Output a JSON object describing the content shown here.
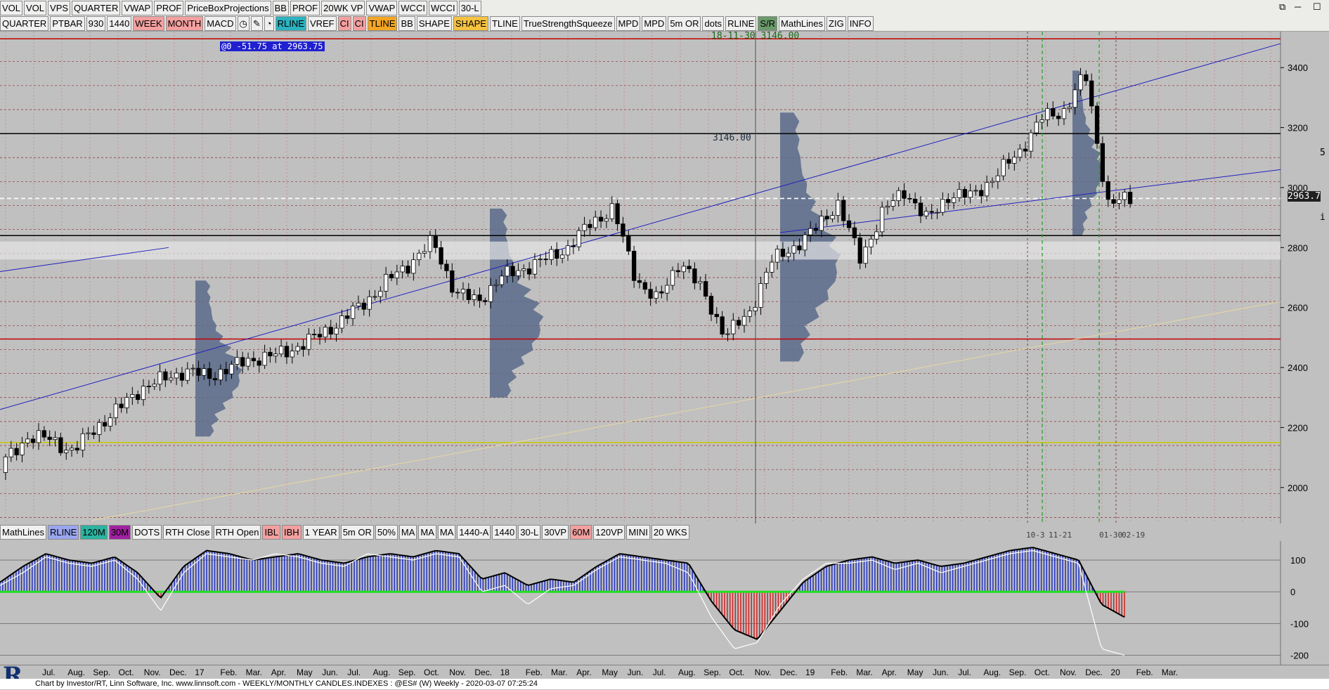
{
  "toolbar1": [
    "VOL",
    "VOL",
    "VPS",
    "QUARTER",
    "VWAP",
    "PROF",
    "PriceBoxProjections",
    "BB",
    "PROF",
    "20WK VP",
    "VWAP",
    "WCCI",
    "WCCI",
    "30-L"
  ],
  "toolbar2": [
    {
      "label": "QUARTER",
      "bg": "#f0f0f0"
    },
    {
      "label": "PTBAR",
      "bg": "#f0f0f0"
    },
    {
      "label": "930",
      "bg": "#f0f0f0"
    },
    {
      "label": "1440",
      "bg": "#f0f0f0"
    },
    {
      "label": "WEEK",
      "bg": "#f4a0a0"
    },
    {
      "label": "MONTH",
      "bg": "#f4a0a0"
    },
    {
      "label": "MACD",
      "bg": "#f0f0f0"
    },
    {
      "label": "clock-icon",
      "icon": true,
      "glyph": "◷"
    },
    {
      "label": "pencil-icon",
      "icon": true,
      "glyph": "✎"
    },
    {
      "label": "drop-icon",
      "icon": true,
      "glyph": "◔"
    },
    {
      "label": "RLINE",
      "bg": "#2bb3c0"
    },
    {
      "label": "VREF",
      "bg": "#f0f0f0"
    },
    {
      "label": "CI",
      "bg": "#f4a0a0"
    },
    {
      "label": "CI",
      "bg": "#f4a0a0"
    },
    {
      "label": "TLINE",
      "bg": "#f5a623"
    },
    {
      "label": "BB",
      "bg": "#f0f0f0"
    },
    {
      "label": "SHAPE",
      "bg": "#f0f0f0"
    },
    {
      "label": "SHAPE",
      "bg": "#f5c242"
    },
    {
      "label": "TLINE",
      "bg": "#f0f0f0"
    },
    {
      "label": "TrueStrengthSqueeze",
      "bg": "#f0f0f0"
    },
    {
      "label": "MPD",
      "bg": "#f0f0f0"
    },
    {
      "label": "MPD",
      "bg": "#f0f0f0"
    },
    {
      "label": "5m OR",
      "bg": "#f0f0f0"
    },
    {
      "label": "dots",
      "bg": "#f0f0f0"
    },
    {
      "label": "RLINE",
      "bg": "#f0f0f0"
    },
    {
      "label": "S/R",
      "bg": "#6b9a6b"
    },
    {
      "label": "MathLines",
      "bg": "#f0f0f0"
    },
    {
      "label": "ZIG",
      "bg": "#f0f0f0"
    },
    {
      "label": "INFO",
      "bg": "#f0f0f0"
    }
  ],
  "toolbar3": [
    {
      "label": "MathLines",
      "bg": "#f0f0f0"
    },
    {
      "label": "RLINE",
      "bg": "#9aa6f0"
    },
    {
      "label": "120M",
      "bg": "#2bb3a0"
    },
    {
      "label": "30M",
      "bg": "#a020a0"
    },
    {
      "label": "DOTS",
      "bg": "#f0f0f0"
    },
    {
      "label": "RTH Close",
      "bg": "#f0f0f0"
    },
    {
      "label": "RTH Open",
      "bg": "#f0f0f0"
    },
    {
      "label": "IBL",
      "bg": "#f4a0a0"
    },
    {
      "label": "IBH",
      "bg": "#f4a0a0"
    },
    {
      "label": "1 YEAR",
      "bg": "#f0f0f0"
    },
    {
      "label": "5m OR",
      "bg": "#f0f0f0"
    },
    {
      "label": "50%",
      "bg": "#f0f0f0"
    },
    {
      "label": "MA",
      "bg": "#f0f0f0"
    },
    {
      "label": "MA",
      "bg": "#f0f0f0"
    },
    {
      "label": "MA",
      "bg": "#f0f0f0"
    },
    {
      "label": "1440-A",
      "bg": "#f0f0f0"
    },
    {
      "label": "1440",
      "bg": "#f0f0f0"
    },
    {
      "label": "30-L",
      "bg": "#f0f0f0"
    },
    {
      "label": "30VP",
      "bg": "#f0f0f0"
    },
    {
      "label": "60M",
      "bg": "#f4a0a0"
    },
    {
      "label": "120VP",
      "bg": "#f0f0f0"
    },
    {
      "label": "MINI",
      "bg": "#f0f0f0"
    },
    {
      "label": "20 WKS",
      "bg": "#f0f0f0"
    }
  ],
  "labels": {
    "cursor_info": "@0  -51.75 at 2963.75",
    "date_price": "18-11-30 3146.00",
    "level_label": "3146.00",
    "price_tag": "2963.7",
    "marker_left": "10-3",
    "marker_mid": "11-21",
    "marker_right": "01-30",
    "marker_right2": "02-19",
    "side_mark_5": "5",
    "side_mark_i": "i"
  },
  "footer": "Chart by Investor/RT, Linn Software, Inc. www.linnsoft.com - WEEKLY/MONTHLY CANDLES.INDEXES : @ES# (W) Weekly - 2020-03-07 07:25:24",
  "logo": "R",
  "chart_data": [
    {
      "type": "candlestick",
      "title": "",
      "y_ticks": [
        2000,
        2200,
        2400,
        2600,
        2800,
        3000,
        3200,
        3400
      ],
      "ylim": [
        1880,
        3520
      ],
      "x_ticks": [
        "Jul.",
        "Aug.",
        "Sep.",
        "Oct.",
        "Nov.",
        "Dec.",
        "17",
        "Feb.",
        "Mar.",
        "Apr.",
        "May",
        "Jun.",
        "Jul.",
        "Aug.",
        "Sep.",
        "Oct.",
        "Nov.",
        "Dec.",
        "18",
        "Feb.",
        "Mar.",
        "Apr.",
        "May",
        "Jun.",
        "Jul.",
        "Aug.",
        "Sep.",
        "Oct.",
        "Nov.",
        "Dec.",
        "19",
        "Feb.",
        "Mar.",
        "Apr.",
        "May",
        "Jun.",
        "Jul.",
        "Aug.",
        "Sep.",
        "Oct.",
        "Nov.",
        "Dec.",
        "20",
        "Feb.",
        "Mar."
      ],
      "close_path": [
        2090,
        2170,
        2160,
        2120,
        2200,
        2260,
        2330,
        2360,
        2390,
        2370,
        2400,
        2430,
        2440,
        2470,
        2510,
        2560,
        2620,
        2690,
        2750,
        2820,
        2650,
        2620,
        2700,
        2730,
        2760,
        2800,
        2880,
        2930,
        2700,
        2620,
        2760,
        2650,
        2510,
        2570,
        2750,
        2800,
        2860,
        2950,
        2760,
        2920,
        2990,
        2890,
        2980,
        2970,
        3040,
        3110,
        3230,
        3250,
        3380,
        2950,
        2960
      ],
      "reference_levels": [
        {
          "value": 3496,
          "color": "#c00000"
        },
        {
          "value": 3180,
          "color": "#000000"
        },
        {
          "value": 2840,
          "color": "#000000"
        },
        {
          "value": 2495,
          "color": "#c00000"
        },
        {
          "value": 2150,
          "color": "#c8c800"
        },
        {
          "value": 2963.75,
          "color": "#ffffff"
        }
      ]
    },
    {
      "type": "line",
      "title": "",
      "y_ticks": [
        -200,
        -100,
        0,
        100
      ],
      "ylim": [
        -230,
        160
      ],
      "series": [
        {
          "values": [
            30,
            80,
            120,
            100,
            90,
            110,
            60,
            -20,
            80,
            130,
            120,
            100,
            110,
            120,
            100,
            90,
            110,
            120,
            110,
            130,
            120,
            40,
            60,
            20,
            40,
            30,
            80,
            120,
            110,
            100,
            90,
            -30,
            -120,
            -150,
            -60,
            30,
            80,
            100,
            110,
            90,
            100,
            80,
            90,
            110,
            130,
            140,
            120,
            100,
            -40,
            -80
          ]
        },
        {
          "values": [
            20,
            60,
            110,
            90,
            80,
            100,
            40,
            -60,
            60,
            120,
            110,
            100,
            120,
            110,
            90,
            80,
            120,
            110,
            100,
            120,
            110,
            0,
            20,
            -40,
            10,
            20,
            70,
            110,
            100,
            90,
            60,
            -80,
            -180,
            -160,
            -40,
            40,
            90,
            90,
            100,
            70,
            90,
            60,
            80,
            100,
            120,
            130,
            110,
            90,
            -180,
            -200
          ]
        }
      ]
    }
  ]
}
